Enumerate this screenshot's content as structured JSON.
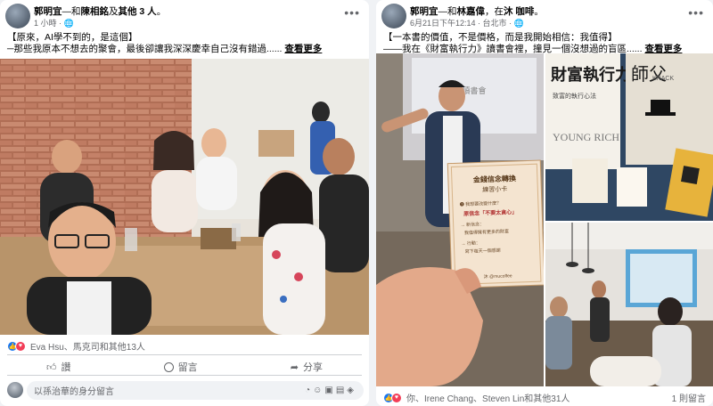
{
  "post1": {
    "author": "郭明宜",
    "with_text": "—和",
    "tagged": "陳相銘",
    "and_text": "及",
    "others": "其他 3 人",
    "dot": "。",
    "time": "1 小時",
    "line1": "【原來，AI學不到的，是這個】",
    "line2": "─那些我原本不想去的聚會，最後卻讓我深深慶幸自己沒有錯過......",
    "see_more": "查看更多",
    "reactions": "Eva Hsu、馬克司和其他13人",
    "like_label": "讚",
    "comment_label": "留言",
    "share_label": "分享",
    "comment_placeholder": "以孫治華的身分留言"
  },
  "post2": {
    "author": "郭明宜",
    "with_text": "—和",
    "tagged": "林嘉偉",
    "at_text": "，在",
    "place": "沐 咖啡",
    "dot": "。",
    "time": "6月21日下午12:14",
    "location": "台北市",
    "line1": "【一本書的價值，不是價格，而是我開始相信：我值得】",
    "line2": "——我在《財富執行力》讀書會裡，撞見一個沒想過的盲區......",
    "see_more": "查看更多",
    "reactions": "你、Irene Chang、Steven Lin和其他31人",
    "comments_count": "1 則留言"
  },
  "card_text": {
    "title": "金錢信念轉換",
    "subtitle": "練習小卡",
    "line_a": "❶ 我想要改變什麼？",
    "line_b": "原信念「不要太貪心」",
    "line_c": "→ 新信念：",
    "line_d": "我值得擁有更多的財富",
    "line_e": "→ 行動：",
    "line_f": "寫下每天一個感謝",
    "footer": "沐 @mucoffee"
  },
  "books": {
    "book1_title": "財富執行力",
    "book1_sub": "致富的執行心法",
    "book1_en": "YOUNG RICH",
    "book2_title": "師父",
    "book2_en": "KNACK"
  },
  "slide_text": "讀書會"
}
